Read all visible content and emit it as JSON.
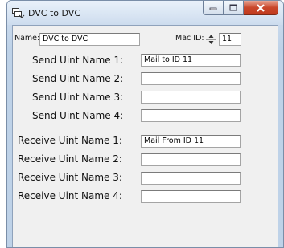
{
  "window": {
    "title": "DVC to DVC"
  },
  "header": {
    "name_label": "Name:",
    "name_value": "DVC to DVC",
    "mac_label": "Mac ID:",
    "mac_value": "11"
  },
  "send": [
    {
      "label": "Send Uint Name 1:",
      "value": "Mail to ID 11"
    },
    {
      "label": "Send Uint Name 2:",
      "value": ""
    },
    {
      "label": "Send Uint Name 3:",
      "value": ""
    },
    {
      "label": "Send Uint Name 4:",
      "value": ""
    }
  ],
  "receive": [
    {
      "label": "Receive Uint Name 1:",
      "value": "Mail From ID 11"
    },
    {
      "label": "Receive Uint Name 2:",
      "value": ""
    },
    {
      "label": "Receive Uint Name 3:",
      "value": ""
    },
    {
      "label": "Receive Uint Name 4:",
      "value": ""
    }
  ],
  "colors": {
    "close_button": "#c9472b",
    "frame": "#c9d9ec",
    "client": "#f0f0f0"
  },
  "icons": [
    "app-icon",
    "minimize-icon",
    "maximize-icon",
    "close-icon",
    "spinner-icon"
  ]
}
